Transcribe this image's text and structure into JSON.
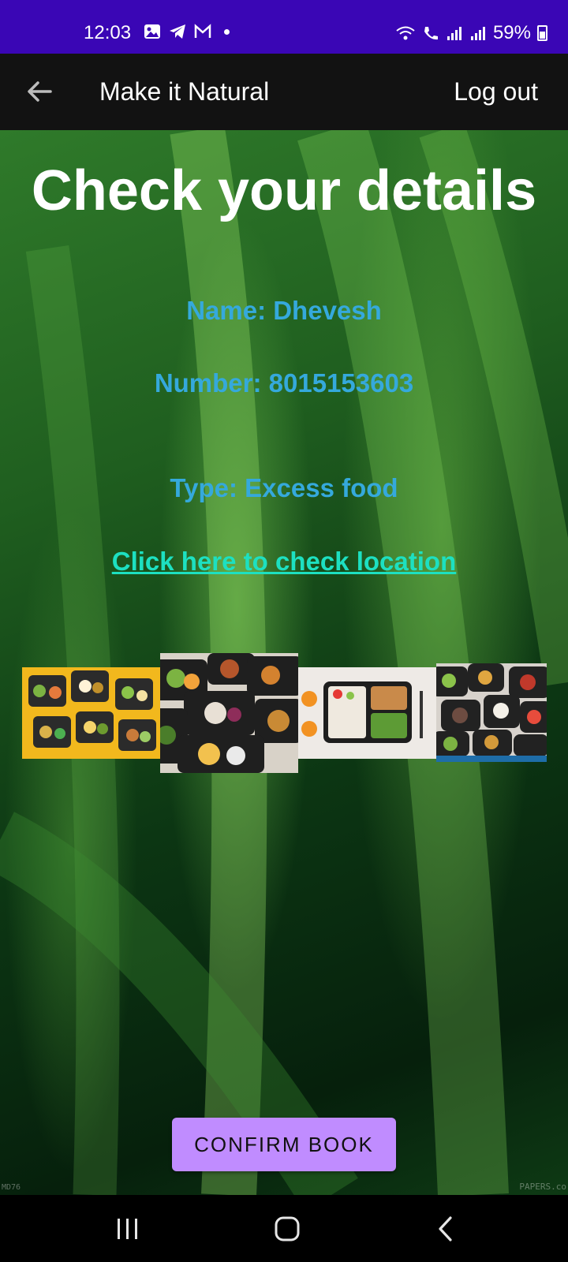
{
  "status_bar": {
    "time": "12:03",
    "battery": "59%",
    "left_icons": [
      "gallery-icon",
      "telegram-icon",
      "gmail-icon"
    ],
    "right_icons": [
      "wifi-icon",
      "wifi-call-icon",
      "signal-icon",
      "signal-icon"
    ]
  },
  "app_bar": {
    "title": "Make it Natural",
    "logout_label": "Log out"
  },
  "main": {
    "headline": "Check your details",
    "name_line": "Name: Dhevesh",
    "number_line": "Number: 8015153603",
    "type_line": "Type: Excess food",
    "location_link": "Click here to check location",
    "confirm_label": "CONFIRM BOOK",
    "watermark_left": "MD76",
    "watermark_right": "PAPERS.co"
  },
  "colors": {
    "status_bar": "#3a06b5",
    "app_bar": "#121212",
    "detail_text": "#35a9dc",
    "link_text": "#1de0c1",
    "button": "#c08cff"
  }
}
